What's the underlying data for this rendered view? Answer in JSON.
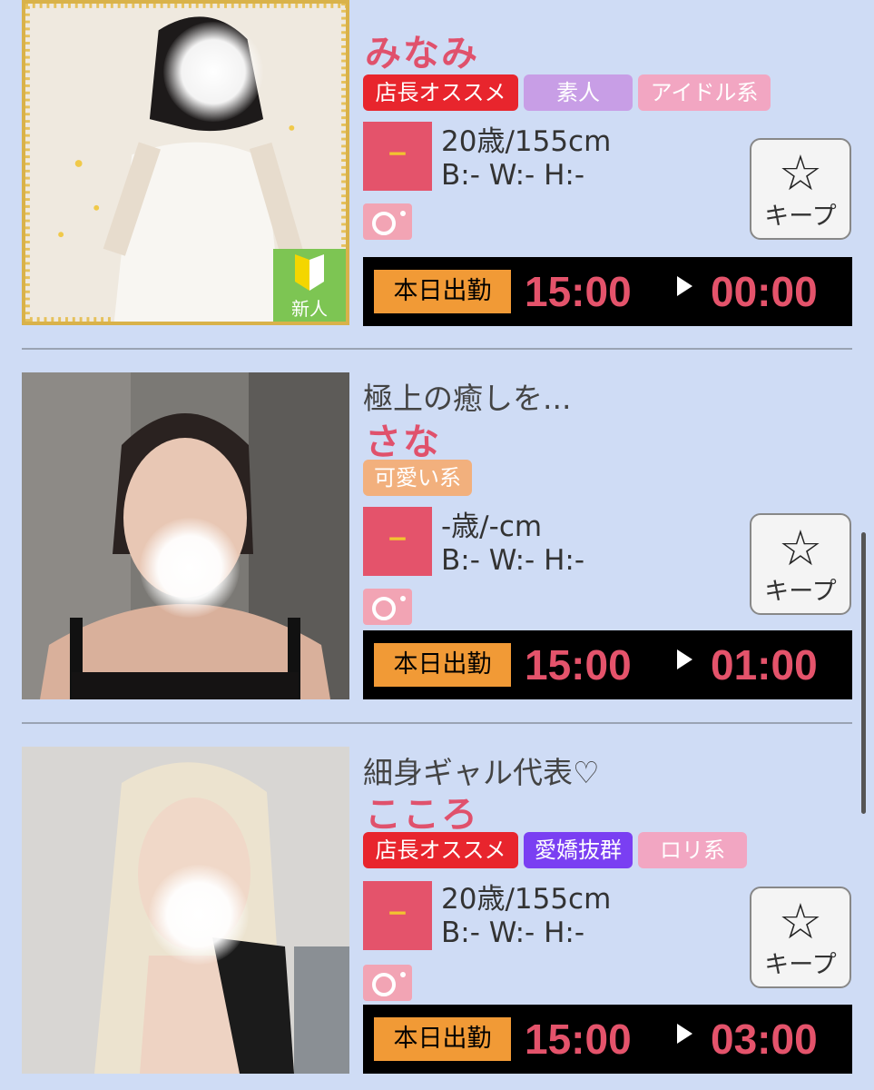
{
  "cast_list": [
    {
      "catch_copy": "",
      "name": "みなみ",
      "tags": [
        "店長オススメ",
        "素人",
        "アイドル系"
      ],
      "is_new": true,
      "new_label": "新人",
      "rank": "−",
      "age_height": "20歳/155cm",
      "sizes": "B:- W:- H:-",
      "keep_label": "キープ",
      "today_label": "本日出勤",
      "start": "15:00",
      "end": "00:00"
    },
    {
      "catch_copy": "極上の癒しを...",
      "name": "さな",
      "tags": [
        "可愛い系"
      ],
      "is_new": false,
      "rank": "−",
      "age_height": "-歳/-cm",
      "sizes": "B:- W:- H:-",
      "keep_label": "キープ",
      "today_label": "本日出勤",
      "start": "15:00",
      "end": "01:00"
    },
    {
      "catch_copy": "細身ギャル代表♡",
      "name": "こころ",
      "tags": [
        "店長オススメ",
        "愛嬌抜群",
        "ロリ系"
      ],
      "is_new": false,
      "rank": "−",
      "age_height": "20歳/155cm",
      "sizes": "B:- W:- H:-",
      "keep_label": "キープ",
      "today_label": "本日出勤",
      "start": "15:00",
      "end": "03:00"
    }
  ],
  "icons": {
    "keep": "star-icon",
    "photo": "camera-icon",
    "arrow": "play-arrow-icon",
    "new": "beginner-leaf-icon"
  },
  "colors": {
    "background": "#cfdcf5",
    "name": "#e0516c",
    "time": "#e4536b",
    "today_badge": "#f19a36",
    "tag_recommend": "#e8252d",
    "tag_amateur": "#c89ee6",
    "tag_idol": "#f2a6c2",
    "tag_cute": "#f2b07d",
    "tag_charm": "#7a3ff2",
    "new_badge": "#7dc553"
  }
}
